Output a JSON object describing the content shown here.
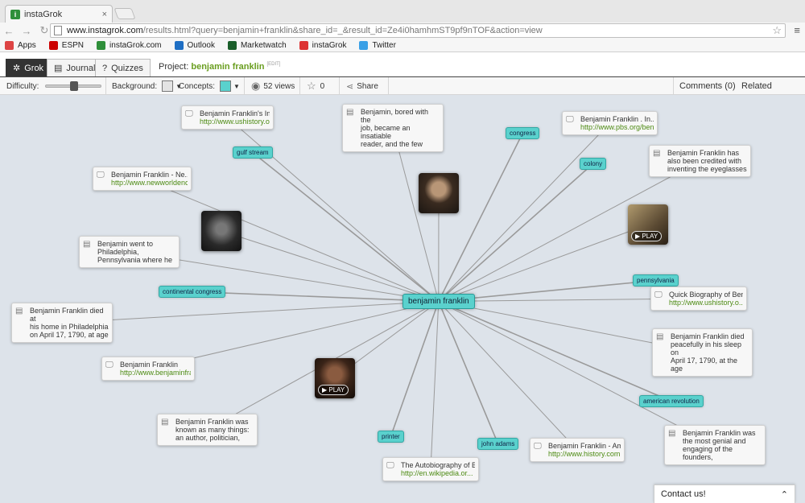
{
  "browser": {
    "tab_title": "instaGrok",
    "tab_close": "×",
    "url_host": "www.instagrok.com",
    "url_path": "/results.html?query=benjamin+franklin&share_id=_&result_id=Ze4i0hamhmST9pf9nTOF&action=view",
    "bookmarks": [
      {
        "label": "Apps",
        "color": "#d44"
      },
      {
        "label": "ESPN",
        "color": "#c00"
      },
      {
        "label": "instaGrok.com",
        "color": "#2f8f3a"
      },
      {
        "label": "Outlook",
        "color": "#1f6fc4"
      },
      {
        "label": "Marketwatch",
        "color": "#1a5e2a"
      },
      {
        "label": "instaGrok",
        "color": "#d33"
      },
      {
        "label": "Twitter",
        "color": "#3aa0e6"
      }
    ]
  },
  "app": {
    "modes": [
      {
        "label": "Grok",
        "icon": "✲"
      },
      {
        "label": "Journal",
        "icon": "▤"
      },
      {
        "label": "Quizzes",
        "icon": "?"
      }
    ],
    "project_label": "Project:",
    "project_name": "benjamin franklin",
    "edit_label": "[EDIT]",
    "difficulty_label": "Difficulty:",
    "difficulty_level": 0.5,
    "background_label": "Background:",
    "background_color": "#e4e4e4",
    "concepts_label": "Concepts:",
    "concepts_color": "#5ad1cd",
    "views": "52 views",
    "stars": "0",
    "share_label": "Share",
    "comments_label": "Comments (0)",
    "related_label": "Related",
    "contact_label": "Contact us!"
  },
  "map": {
    "center": "benjamin franklin",
    "concepts": [
      "gulf stream",
      "congress",
      "colony",
      "continental congress",
      "pennsylvania",
      "american revolution",
      "printer",
      "john adams"
    ],
    "cards": [
      {
        "type": "web",
        "title": "Benjamin Franklin's In...",
        "url": "http://www.ushistory.o..."
      },
      {
        "type": "fact",
        "lines": [
          "Benjamin, bored with the",
          "job, became an insatiable",
          "reader, and the few"
        ]
      },
      {
        "type": "web",
        "title": "Benjamin Franklin . In...",
        "url": "http://www.pbs.org/ben..."
      },
      {
        "type": "fact",
        "lines": [
          "Benjamin Franklin has",
          "also been credited with",
          "inventing the eyeglasses"
        ]
      },
      {
        "type": "web",
        "title": "Benjamin Franklin - Ne...",
        "url": "http://www.newworldenc..."
      },
      {
        "type": "fact",
        "lines": [
          "Benjamin went to",
          "Philadelphia,",
          "Pennsylvania where he"
        ]
      },
      {
        "type": "web",
        "title": "Quick Biography of Ben...",
        "url": "http://www.ushistory.o..."
      },
      {
        "type": "fact",
        "lines": [
          "Benjamin Franklin died at",
          "his home in Philadelphia",
          "on April 17, 1790, at age"
        ]
      },
      {
        "type": "fact",
        "lines": [
          "Benjamin Franklin died",
          "peacefully in his sleep on",
          "April 17, 1790, at the age"
        ]
      },
      {
        "type": "web",
        "title": "Benjamin Franklin",
        "url": "http://www.benjaminfra..."
      },
      {
        "type": "fact",
        "lines": [
          "Benjamin Franklin was",
          "known as many things:",
          "an author, politician,"
        ]
      },
      {
        "type": "fact",
        "lines": [
          "Benjamin Franklin was",
          "the most genial and",
          "engaging of the founders,"
        ]
      },
      {
        "type": "web",
        "title": "Benjamin Franklin - Am...",
        "url": "http://www.history.com..."
      },
      {
        "type": "web",
        "title": "The Autobiography of B...",
        "url": "http://en.wikipedia.or..."
      }
    ],
    "play_label": "PLAY"
  }
}
